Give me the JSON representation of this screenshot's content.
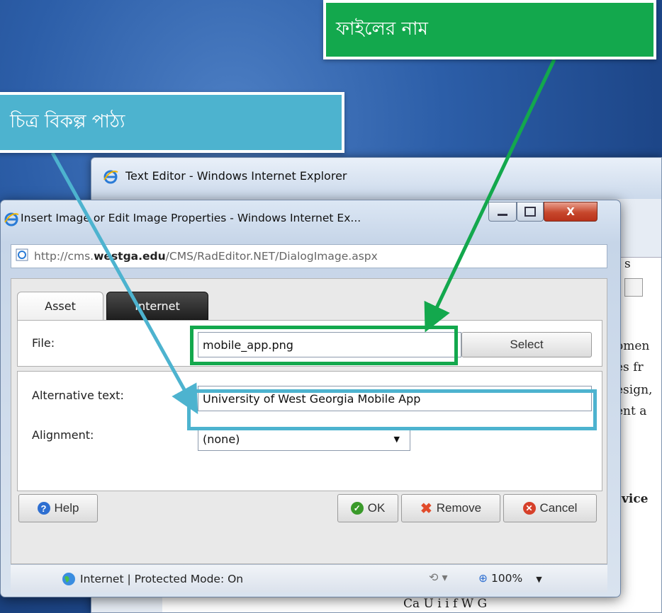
{
  "callouts": {
    "file_name": "ফাইলের নাম",
    "alt_text": "চিত্র বিকল্প পাঠ্য",
    "file_color": "#13a84d",
    "alt_color": "#4db3cf"
  },
  "background_window": {
    "title": "Text Editor - Windows Internet Explorer",
    "content_fragments": [
      "s",
      "omen",
      "es fr",
      "esign,",
      "ent a",
      "vice"
    ],
    "bottom_text": "Ca        U i      i   f W    G"
  },
  "dialog": {
    "title": "Insert Image or Edit Image Properties - Windows Internet Ex...",
    "address": {
      "prefix": "http://cms.",
      "host": "westga.edu",
      "suffix": "/CMS/RadEditor.NET/DialogImage.aspx"
    },
    "tabs": [
      {
        "label": "Asset",
        "active": true
      },
      {
        "label": "Internet",
        "active": false
      }
    ],
    "file": {
      "label": "File:",
      "value": "mobile_app.png",
      "select_label": "Select"
    },
    "alternative_text": {
      "label": "Alternative text:",
      "value": "University of West Georgia Mobile App"
    },
    "alignment": {
      "label": "Alignment:",
      "value": "(none)"
    },
    "buttons": {
      "help": "Help",
      "ok": "OK",
      "remove": "Remove",
      "cancel": "Cancel"
    },
    "statusbar": {
      "zone": "Internet | Protected Mode: On",
      "zoom": "100%"
    }
  }
}
